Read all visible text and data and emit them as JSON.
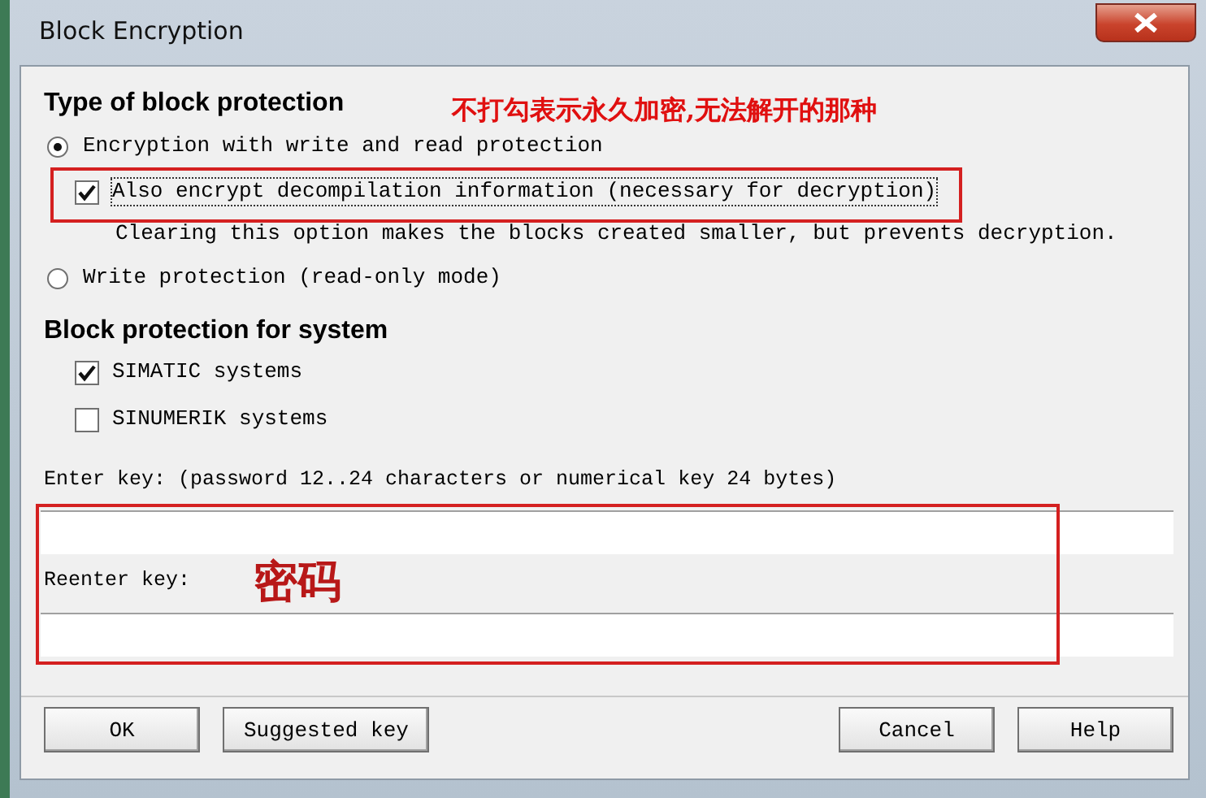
{
  "window": {
    "title": "Block Encryption"
  },
  "protection_type": {
    "heading": "Type of block protection",
    "options": [
      {
        "kind": "radio",
        "label": "Encryption with write and read protection",
        "selected": true
      },
      {
        "kind": "checkbox",
        "label": "Also encrypt decompilation information (necessary for decryption)",
        "checked": true,
        "note": "Clearing this option makes the blocks created smaller, but prevents decryption."
      },
      {
        "kind": "radio",
        "label": "Write protection (read-only mode)",
        "selected": false
      }
    ]
  },
  "system_protection": {
    "heading": "Block protection for system",
    "systems": [
      {
        "label": "SIMATIC systems",
        "checked": true
      },
      {
        "label": "SINUMERIK systems",
        "checked": false
      }
    ]
  },
  "key_fields": [
    {
      "label": "Enter key: (password 12..24 characters or numerical key 24 bytes)"
    },
    {
      "label": "Reenter key:"
    }
  ],
  "buttons_left": [
    "OK",
    "Suggested key"
  ],
  "buttons_right": [
    "Cancel",
    "Help"
  ],
  "annotations": [
    {
      "text": "不打勾表示永久加密,无法解开的那种"
    },
    {
      "text": "密码"
    }
  ]
}
